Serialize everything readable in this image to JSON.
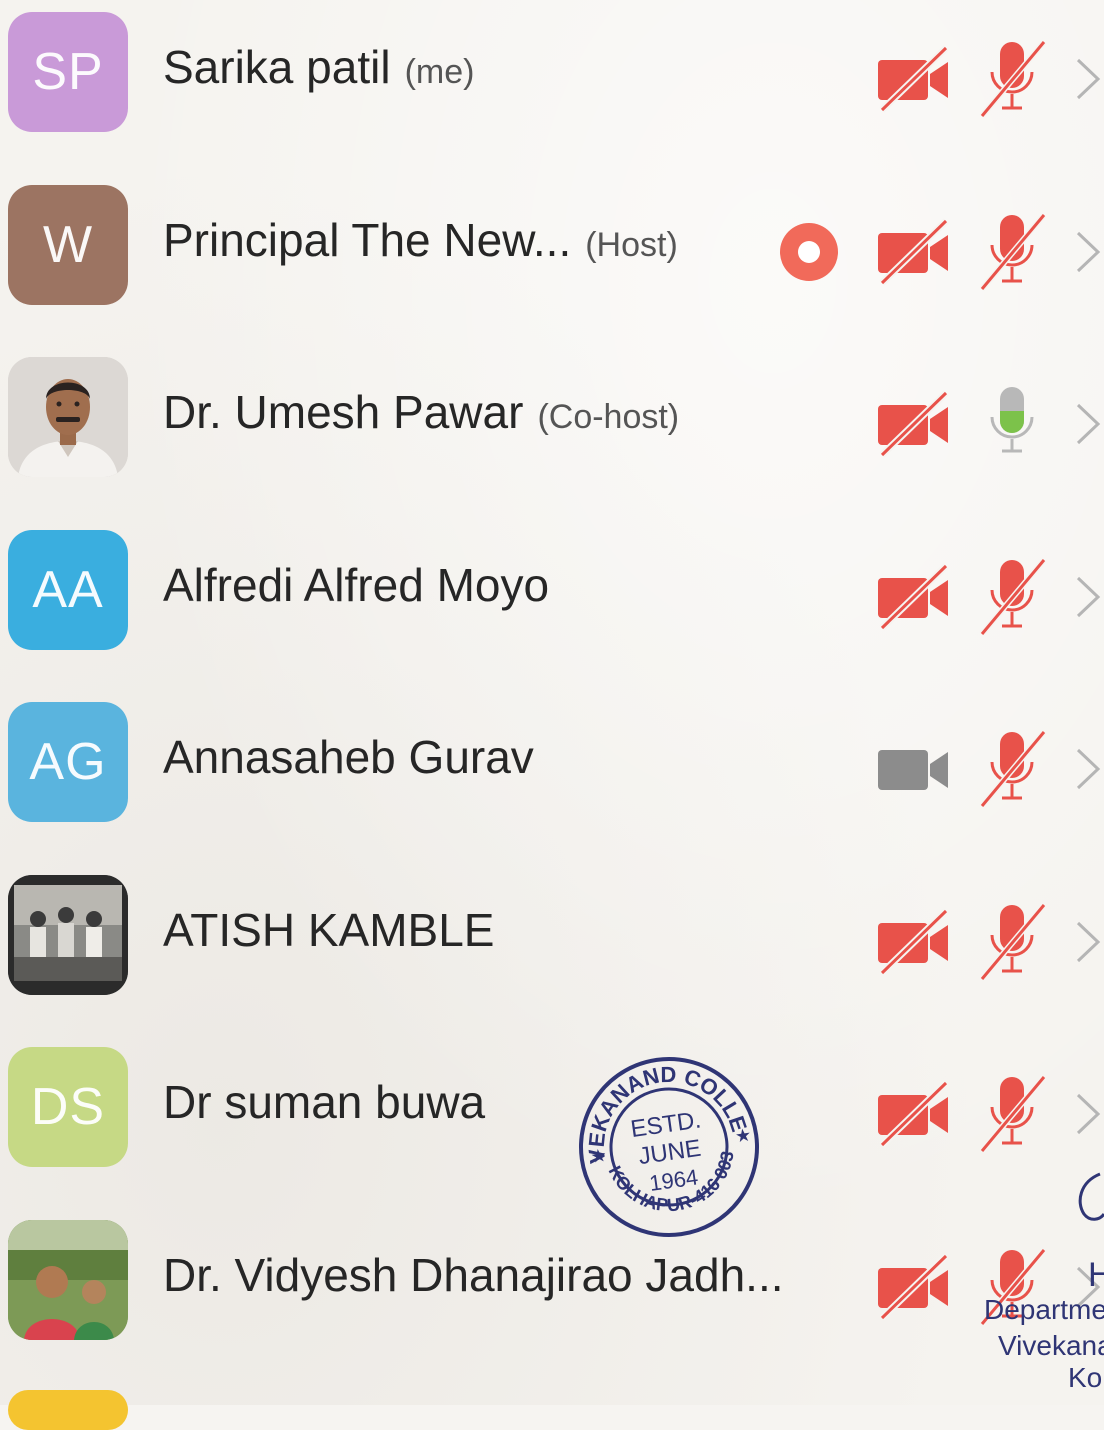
{
  "participants": [
    {
      "initials": "SP",
      "avatar_color": "#c99ad8",
      "name": "Sarika patil",
      "role": "(me)",
      "recording": false,
      "video": "off",
      "mic": "muted"
    },
    {
      "initials": "W",
      "avatar_color": "#9c7462",
      "name": "Principal The New...",
      "role": "(Host)",
      "recording": true,
      "video": "off",
      "mic": "muted"
    },
    {
      "initials": "",
      "avatar_color": "#d8d4d0",
      "avatar_photo": "portrait-man",
      "name": "Dr. Umesh Pawar",
      "role": "(Co-host)",
      "recording": false,
      "video": "off",
      "mic": "active"
    },
    {
      "initials": "AA",
      "avatar_color": "#3aaedf",
      "name": "Alfredi Alfred Moyo",
      "role": "",
      "recording": false,
      "video": "off",
      "mic": "muted"
    },
    {
      "initials": "AG",
      "avatar_color": "#5ab4de",
      "name": "Annasaheb Gurav",
      "role": "",
      "recording": false,
      "video": "unavailable",
      "mic": "muted"
    },
    {
      "initials": "",
      "avatar_color": "#5a5a5a",
      "avatar_photo": "group-photo",
      "name": "ATISH KAMBLE",
      "role": "",
      "recording": false,
      "video": "off",
      "mic": "muted"
    },
    {
      "initials": "DS",
      "avatar_color": "#c6d985",
      "name": "Dr suman buwa",
      "role": "",
      "recording": false,
      "video": "off",
      "mic": "muted"
    },
    {
      "initials": "",
      "avatar_color": "#7b9a5a",
      "avatar_photo": "outdoor-photo",
      "name": "Dr. Vidyesh Dhanajirao Jadh...",
      "role": "",
      "recording": false,
      "video": "off",
      "mic": "muted"
    }
  ],
  "colors": {
    "muted_red": "#e8524a",
    "record_red": "#f16a5a",
    "mic_active_green": "#7cc24a",
    "mic_grey": "#b8b8b8",
    "cam_grey": "#8c8c8c",
    "stamp_ink": "#2f3575"
  },
  "stamp": {
    "ring_text": "VIVEKANAND COLLEGE",
    "bottom_text": "KOLHAPUR-416 003",
    "line1": "ESTD.",
    "line2": "JUNE",
    "line3": "1964"
  },
  "signature_block": {
    "initial": "H",
    "line1": "Departme",
    "line2": "Vivekana",
    "line3": "Ko"
  }
}
